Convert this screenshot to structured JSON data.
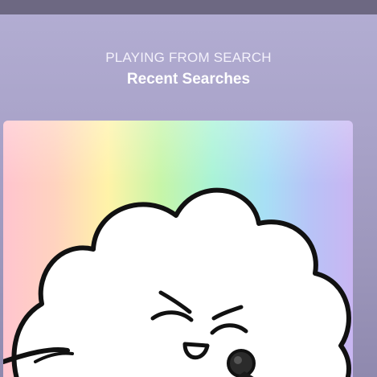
{
  "now_playing": {
    "context_label": "PLAYING FROM SEARCH",
    "context_title": "Recent Searches"
  },
  "artwork": {
    "icon": "cloud-character-with-microphone",
    "style": "rainbow gradient background"
  },
  "colors": {
    "background_top": "#b3aed3",
    "background_bottom": "#8f89ae",
    "top_strip": "#6d6882",
    "text": "#ffffff"
  }
}
